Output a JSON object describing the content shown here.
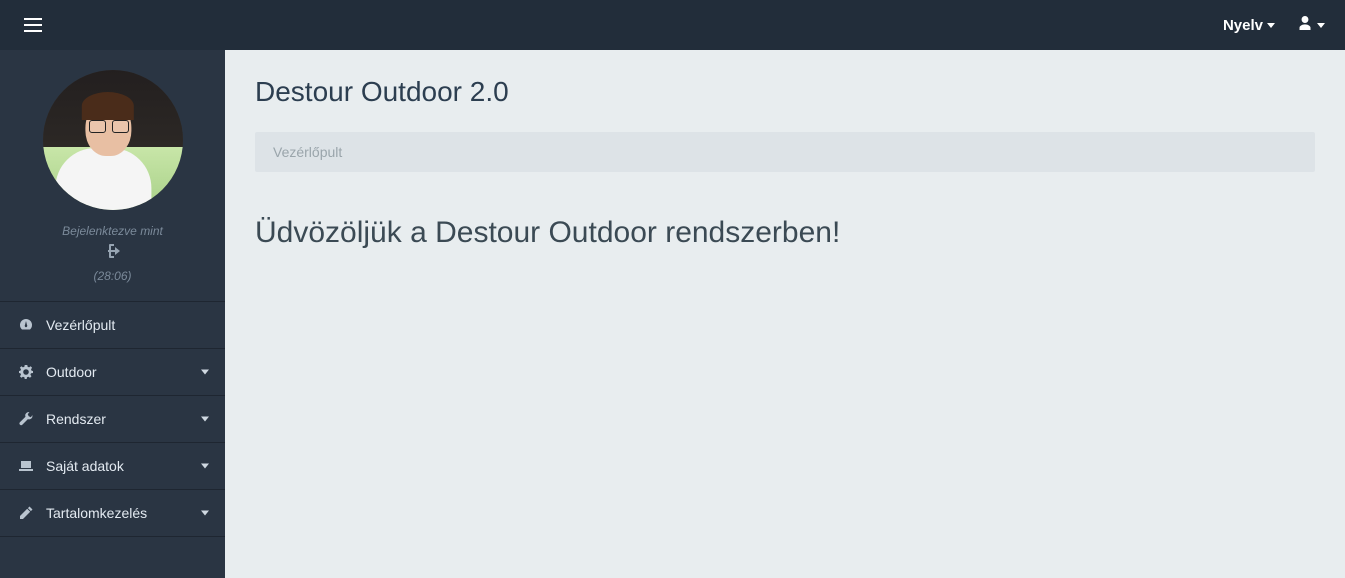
{
  "topbar": {
    "language_label": "Nyelv"
  },
  "user": {
    "logged_in_label": "Bejelenktezve mint",
    "timer": "(28:06)"
  },
  "nav": {
    "items": [
      {
        "label": "Vezérlőpult",
        "icon": "dashboard",
        "expandable": false
      },
      {
        "label": "Outdoor",
        "icon": "gear",
        "expandable": true
      },
      {
        "label": "Rendszer",
        "icon": "wrench",
        "expandable": true
      },
      {
        "label": "Saját adatok",
        "icon": "laptop",
        "expandable": true
      },
      {
        "label": "Tartalomkezelés",
        "icon": "pencil",
        "expandable": true
      }
    ]
  },
  "page": {
    "title": "Destour Outdoor 2.0",
    "breadcrumb": "Vezérlőpult",
    "welcome": "Üdvözöljük a Destour Outdoor rendszerben!"
  }
}
